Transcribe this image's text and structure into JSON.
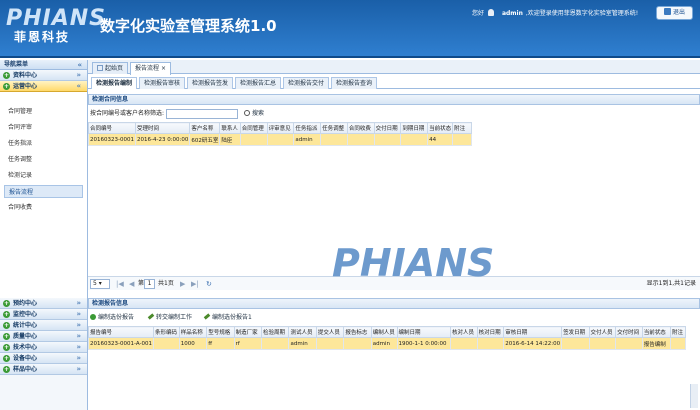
{
  "header": {
    "logo_en": "PHIANS",
    "logo_cn": "菲恩科技",
    "app_title": "数字化实验室管理系统1.0",
    "greeting": "您好",
    "username": "admin",
    "welcome": ",欢迎登录使用菲恩数字化实验室管理系统!",
    "logout_label": "退出"
  },
  "sidebar": {
    "title": "导航菜单",
    "collapse_glyph": "«",
    "categories": [
      {
        "label": "资料中心",
        "state": "collapsed"
      },
      {
        "label": "运营中心",
        "state": "expanded"
      }
    ],
    "items": [
      "合同管理",
      "合同评审",
      "任务指派",
      "任务调整",
      "检测记录",
      "报告流程",
      "合同收费"
    ],
    "active_item": "报告流程",
    "bottom_categories": [
      "预约中心",
      "监控中心",
      "统计中心",
      "质量中心",
      "技术中心",
      "设备中心",
      "样品中心"
    ]
  },
  "tabs": [
    {
      "label": "起始页",
      "closable": false
    },
    {
      "label": "报告流程",
      "closable": true
    }
  ],
  "close_glyph": "×",
  "subtabs": [
    "检测报告编制",
    "检测报告审核",
    "检测报告签发",
    "检测报告汇总",
    "检测报告交付",
    "检测报告查询"
  ],
  "contract_panel": {
    "title": "检测合同信息",
    "search_label": "按合同编号或客户名称筛选:",
    "search_value": "",
    "search_button": "搜索",
    "columns": [
      "合同编号",
      "受理时间",
      "客户名称",
      "联系人",
      "合同管理",
      "评审意见",
      "任务指派",
      "任务调整",
      "合同收费",
      "交付日期",
      "到期日期",
      "当前状态",
      "附注"
    ],
    "rows": [
      [
        "20160323-0001",
        "2016-4-23 0:00:00",
        "602研五室",
        "陆臣",
        "",
        "",
        "admin",
        "",
        "",
        "",
        "",
        "44",
        ""
      ]
    ]
  },
  "pager": {
    "page_size": "5",
    "page_label": "第",
    "page_value": "1",
    "total_pages": "共1页",
    "info": "显示1到1,共1记录"
  },
  "report_panel": {
    "title": "检测报告信息",
    "buttons": [
      "编制选份报告",
      "转交编制工作",
      "编制选份报告1"
    ],
    "columns": [
      "报告编号",
      "条形编码",
      "样品名称",
      "型号规格",
      "制造厂家",
      "检验周期",
      "测试人员",
      "提交人员",
      "报告标志",
      "编制人员",
      "编制日期",
      "核对人员",
      "核对日期",
      "审核日期",
      "签发日期",
      "交付人员",
      "交付时间",
      "当前状态",
      "附注"
    ],
    "rows": [
      [
        "20160323-0001-A-001",
        "",
        "1000",
        "ff",
        "rf",
        "",
        "admin",
        "",
        "",
        "admin",
        "1900-1-1 0:00:00",
        "",
        "",
        "2016-6-14 14:22:00",
        "",
        "",
        "",
        "报告编制",
        ""
      ]
    ]
  },
  "colors": {
    "header_blue": "#2f7fd0",
    "selected_row": "#fde79a",
    "active_category": "#ffd969"
  }
}
